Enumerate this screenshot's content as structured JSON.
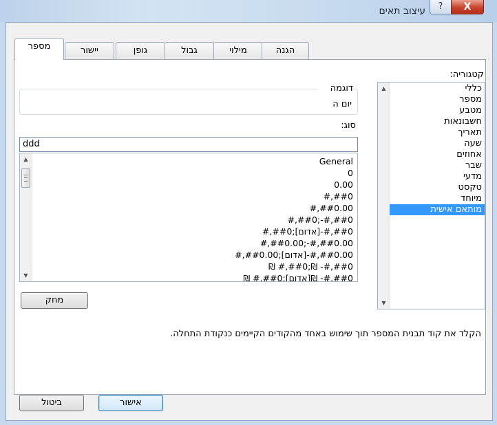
{
  "window": {
    "title": "עיצוב תאים",
    "help_label": "?",
    "close_label": "X"
  },
  "tabs": [
    {
      "label": "מספר",
      "active": true
    },
    {
      "label": "יישור"
    },
    {
      "label": "גופן"
    },
    {
      "label": "גבול"
    },
    {
      "label": "מילוי"
    },
    {
      "label": "הגנה"
    }
  ],
  "category": {
    "label": "קטגוריה:",
    "items": [
      "כללי",
      "מספר",
      "מטבע",
      "חשבונאות",
      "תאריך",
      "שעה",
      "אחוזים",
      "שבר",
      "מדעי",
      "טקסט",
      "מיוחד",
      "מותאם אישית"
    ],
    "selected_index": 11
  },
  "sample": {
    "label": "דוגמה",
    "value": "יום ה"
  },
  "type": {
    "label": "סוג:",
    "value": "ddd",
    "formats": [
      "General",
      "0",
      "0.00",
      "#,##0",
      "#,##0.00",
      "#,##0;-#,##0",
      "#,##0;[אדום]-#,##0",
      "#,##0.00;-#,##0.00",
      "#,##0.00;[אדום]-#,##0.00",
      "₪ #,##0;₪ -#,##0",
      "₪ #,##0;[אדום]₪ -#,##0"
    ]
  },
  "delete_button": "מחק",
  "hint": "הקלד את קוד תבנית המספר תוך שימוש באחד מהקודים הקיימים כנקודת התחלה.",
  "ok_button": "אישור",
  "cancel_button": "ביטול",
  "icons": {
    "scroll_up": "▲",
    "scroll_down": "▼"
  }
}
